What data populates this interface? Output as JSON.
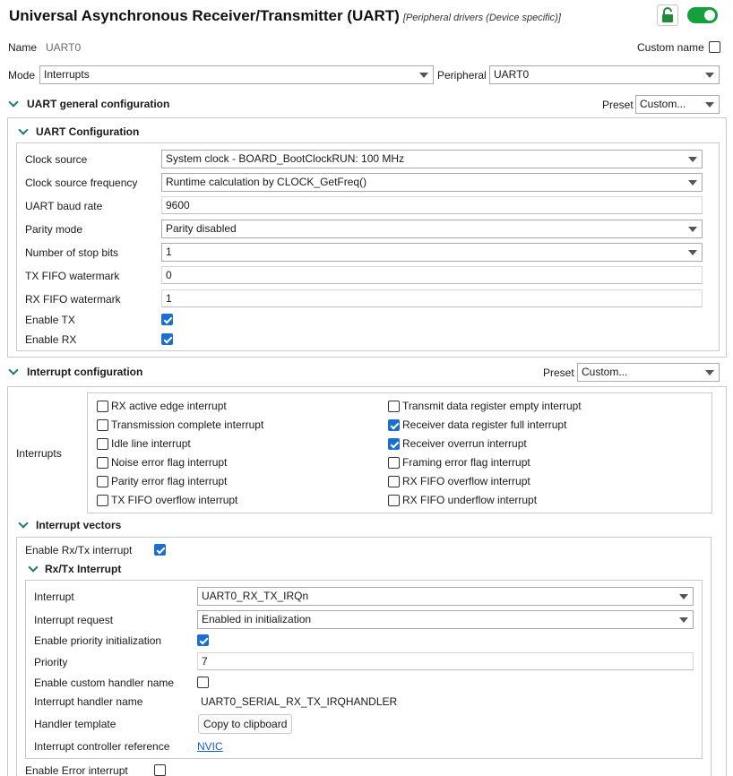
{
  "header": {
    "title": "Universal Asynchronous Receiver/Transmitter (UART)",
    "subtitle": "[Peripheral drivers (Device specific)]",
    "lock_icon": "unlock-icon",
    "enabled_toggle": true
  },
  "name_row": {
    "label": "Name",
    "value": "UART0",
    "custom_name_label": "Custom name",
    "custom_name_checked": false
  },
  "mode_row": {
    "label": "Mode",
    "value": "Interrupts",
    "peripheral_label": "Peripheral",
    "peripheral_value": "UART0"
  },
  "general": {
    "title": "UART general configuration",
    "preset_label": "Preset",
    "preset_value": "Custom...",
    "uart_config": {
      "title": "UART Configuration",
      "clock_source": {
        "label": "Clock source",
        "value": "System clock - BOARD_BootClockRUN: 100 MHz"
      },
      "clock_freq": {
        "label": "Clock source frequency",
        "value": "Runtime calculation by CLOCK_GetFreq()"
      },
      "baud": {
        "label": "UART baud rate",
        "value": "9600"
      },
      "parity": {
        "label": "Parity mode",
        "value": "Parity disabled"
      },
      "stop_bits": {
        "label": "Number of stop bits",
        "value": "1"
      },
      "tx_fifo": {
        "label": "TX FIFO watermark",
        "value": "0"
      },
      "rx_fifo": {
        "label": "RX FIFO watermark",
        "value": "1"
      },
      "enable_tx": {
        "label": "Enable TX",
        "checked": true
      },
      "enable_rx": {
        "label": "Enable RX",
        "checked": true
      }
    }
  },
  "interrupt": {
    "title": "Interrupt configuration",
    "preset_label": "Preset",
    "preset_value": "Custom...",
    "interrupts_label": "Interrupts",
    "left": [
      {
        "label": "RX active edge interrupt",
        "checked": false
      },
      {
        "label": "Transmission complete interrupt",
        "checked": false
      },
      {
        "label": "Idle line interrupt",
        "checked": false
      },
      {
        "label": "Noise error flag interrupt",
        "checked": false
      },
      {
        "label": "Parity error flag interrupt",
        "checked": false
      },
      {
        "label": "TX FIFO overflow interrupt",
        "checked": false
      }
    ],
    "right": [
      {
        "label": "Transmit data register empty interrupt",
        "checked": false
      },
      {
        "label": "Receiver data register full interrupt",
        "checked": true
      },
      {
        "label": "Receiver overrun interrupt",
        "checked": true
      },
      {
        "label": "Framing error flag interrupt",
        "checked": false
      },
      {
        "label": "RX FIFO overflow interrupt",
        "checked": false
      },
      {
        "label": "RX FIFO underflow interrupt",
        "checked": false
      }
    ],
    "vectors": {
      "title": "Interrupt vectors",
      "enable_rxtx": {
        "label": "Enable Rx/Tx interrupt",
        "checked": true
      },
      "rxtx": {
        "title": "Rx/Tx Interrupt",
        "interrupt": {
          "label": "Interrupt",
          "value": "UART0_RX_TX_IRQn"
        },
        "request": {
          "label": "Interrupt request",
          "value": "Enabled in initialization"
        },
        "priority_init": {
          "label": "Enable priority initialization",
          "checked": true
        },
        "priority": {
          "label": "Priority",
          "value": "7"
        },
        "custom_handler": {
          "label": "Enable custom handler name",
          "checked": false
        },
        "handler_name": {
          "label": "Interrupt handler name",
          "value": "UART0_SERIAL_RX_TX_IRQHANDLER"
        },
        "handler_template": {
          "label": "Handler template",
          "button": "Copy to clipboard"
        },
        "controller_ref": {
          "label": "Interrupt controller reference",
          "link": "NVIC"
        }
      },
      "enable_error": {
        "label": "Enable Error interrupt",
        "checked": false
      }
    }
  }
}
